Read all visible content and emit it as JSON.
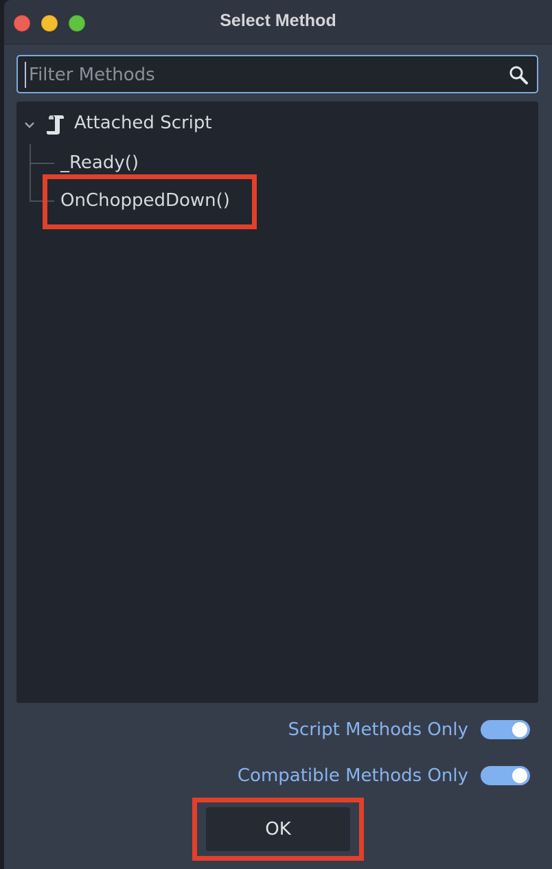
{
  "window": {
    "title": "Select Method"
  },
  "search": {
    "placeholder": "Filter Methods",
    "value": "",
    "icon": "search-icon"
  },
  "tree": {
    "root": {
      "label": "Attached Script",
      "icon": "script-icon",
      "expanded": true
    },
    "items": [
      {
        "label": "_Ready()"
      },
      {
        "label": "OnChoppedDown()",
        "highlighted": true
      }
    ]
  },
  "options": {
    "script_methods_only": {
      "label": "Script Methods Only",
      "enabled": true
    },
    "compatible_methods_only": {
      "label": "Compatible Methods Only",
      "enabled": true
    }
  },
  "buttons": {
    "ok_label": "OK"
  },
  "colors": {
    "accent": "#7fb0ef",
    "highlight": "#e2402b",
    "panel": "#21252d",
    "window": "#363d4a"
  }
}
